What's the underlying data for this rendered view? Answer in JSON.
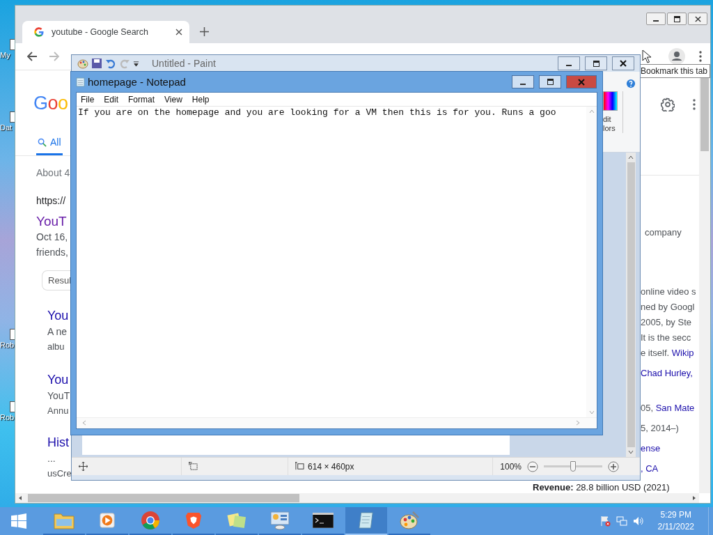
{
  "desktop": {
    "icons": [
      {
        "label": "My"
      },
      {
        "label": "Dat"
      },
      {
        "label": "Rob"
      },
      {
        "label": "Rob"
      }
    ]
  },
  "browser": {
    "tab": {
      "title": "youtube - Google Search"
    },
    "tooltip": "Bookmark this tab",
    "page": {
      "logo": "Goo",
      "search_tabs": [
        {
          "label": "All",
          "selected": true
        }
      ],
      "result_stats": "About 4",
      "top_result": {
        "url": "https://",
        "title": "YouT",
        "snippet": [
          "Oct 16,",
          "friends,"
        ],
        "chip": "Resul"
      },
      "sub_results": [
        {
          "title": "You",
          "snippet": [
            "A ne",
            "albu"
          ]
        },
        {
          "title": "You",
          "snippet": [
            "YouT",
            "Annu"
          ]
        }
      ],
      "next_result": {
        "title": "Hist",
        "snippet": [
          "...",
          "usCre"
        ]
      },
      "knowledge_panel": {
        "blocks": [
          [
            [
              {
                "text": "company"
              }
            ]
          ],
          [
            [
              {
                "text": "online video s"
              }
            ],
            [
              {
                "text": "ned by Googl"
              }
            ],
            [
              {
                "text": "2005, by Ste"
              }
            ],
            [
              {
                "text": "It is the secc"
              }
            ],
            [
              {
                "text": "e itself. "
              },
              {
                "text": "Wikip",
                "link": true
              }
            ]
          ],
          [
            [
              {
                "text": "Chad Hurley, ",
                "link": true
              }
            ]
          ],
          [
            [
              {
                "text": "05, "
              },
              {
                "text": "San Mate",
                "link": true
              }
            ]
          ],
          [
            [
              {
                "text": "5, 2014–)"
              }
            ]
          ],
          [
            [
              {
                "text": "ense",
                "link": true
              }
            ]
          ],
          [
            [
              {
                "text": ", CA",
                "link": true
              }
            ]
          ]
        ],
        "revenue": "**Revenue:** 28.8 billion USD (2021)"
      }
    }
  },
  "paint": {
    "title": "Untitled - Paint",
    "ribbon_label": [
      "dit",
      "lors"
    ],
    "status": {
      "size": "614 × 460px",
      "zoom": "100%",
      "level": 0.5
    }
  },
  "notepad": {
    "title": "homepage - Notepad",
    "menu": [
      "File",
      "Edit",
      "Format",
      "View",
      "Help"
    ],
    "text": "If you are on the homepage and you are looking for a VM then this is for you. Runs a goo"
  },
  "taskbar": {
    "items": [
      {
        "kind": "folder",
        "selected": false
      },
      {
        "kind": "media",
        "selected": false
      },
      {
        "kind": "chrome",
        "selected": false
      },
      {
        "kind": "lion",
        "selected": false
      },
      {
        "kind": "notes",
        "selected": false
      },
      {
        "kind": "panel",
        "selected": false
      },
      {
        "kind": "terminal",
        "selected": false
      },
      {
        "kind": "notepad",
        "selected": true
      },
      {
        "kind": "paint",
        "selected": false
      }
    ],
    "time": "5:29 PM",
    "date": "2/11/2022"
  }
}
